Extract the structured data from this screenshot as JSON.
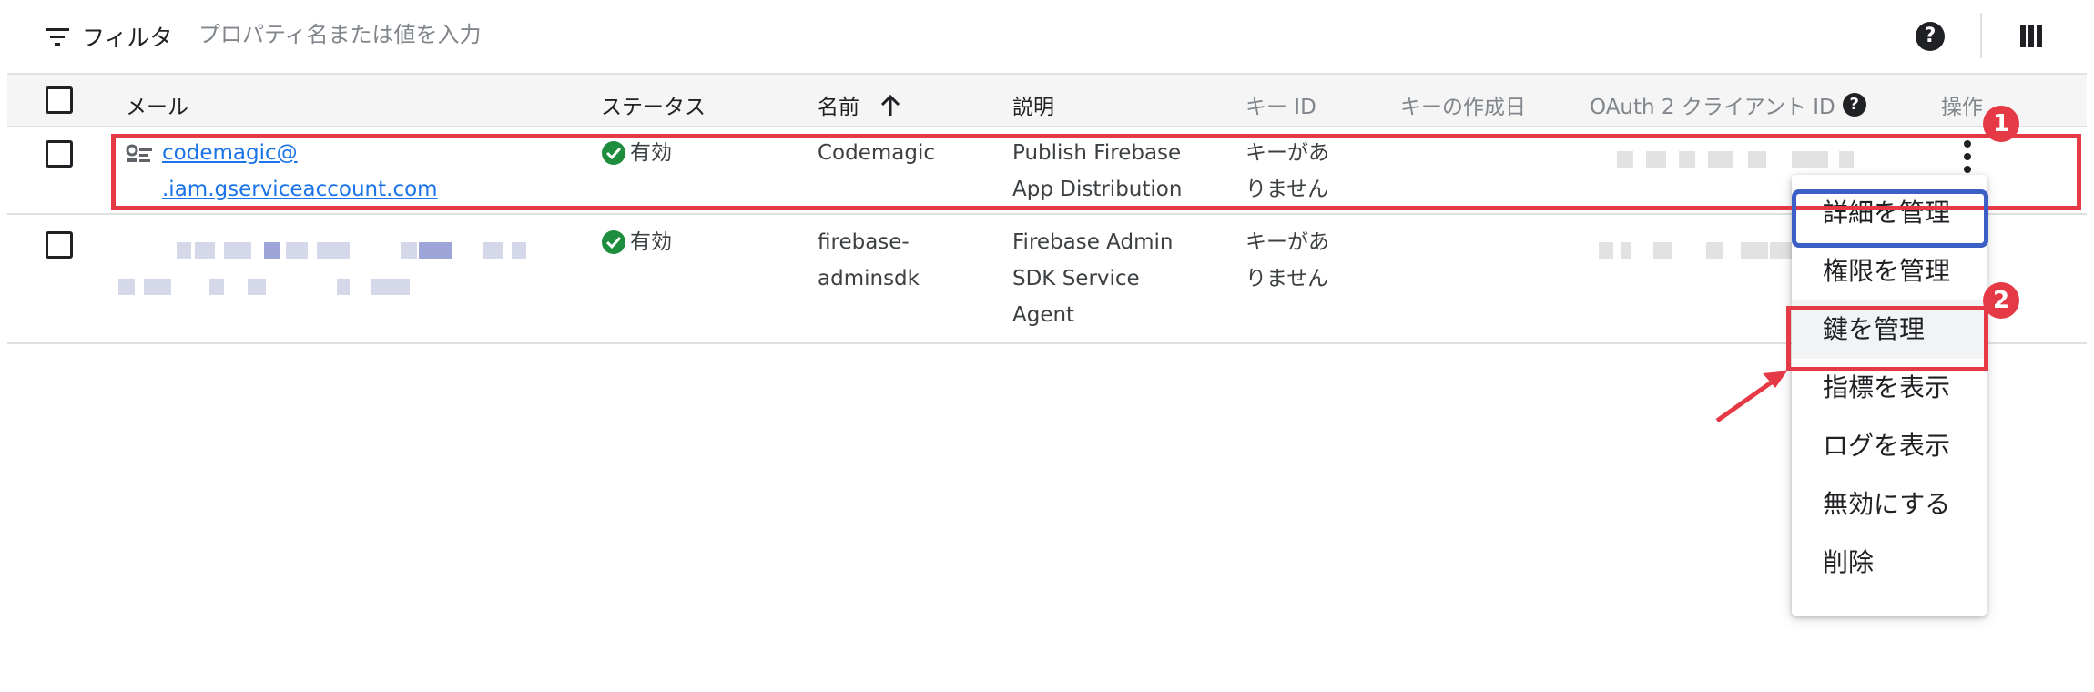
{
  "toolbar": {
    "filter_label": "フィルタ",
    "filter_placeholder": "プロパティ名または値を入力",
    "help_label": "?"
  },
  "table": {
    "columns": [
      {
        "key": "email",
        "label": "メール"
      },
      {
        "key": "status",
        "label": "ステータス"
      },
      {
        "key": "name",
        "label": "名前"
      },
      {
        "key": "description",
        "label": "説明"
      },
      {
        "key": "key_id",
        "label": "キー ID"
      },
      {
        "key": "key_created",
        "label": "キーの作成日"
      },
      {
        "key": "oauth_client_id",
        "label": "OAuth 2 クライアント ID"
      },
      {
        "key": "actions",
        "label": "操作"
      }
    ],
    "rows": [
      {
        "email_line1": "codemagic@",
        "email_line2": ".iam.gserviceaccount.com",
        "status": "有効",
        "name": "Codemagic",
        "description_line1": "Publish Firebase",
        "description_line2": "App Distribution",
        "key_id_line1": "キーがあ",
        "key_id_line2": "りません"
      },
      {
        "status": "有効",
        "name_line1": "firebase-",
        "name_line2": "adminsdk",
        "description_line1": "Firebase Admin",
        "description_line2": "SDK Service",
        "description_line3": "Agent",
        "key_id_line1": "キーがあ",
        "key_id_line2": "りません"
      }
    ]
  },
  "menu": {
    "items": [
      {
        "label": "詳細を管理"
      },
      {
        "label": "権限を管理"
      },
      {
        "label": "鍵を管理"
      },
      {
        "label": "指標を表示"
      },
      {
        "label": "ログを表示"
      },
      {
        "label": "無効にする"
      },
      {
        "label": "削除"
      }
    ]
  },
  "annotations": {
    "badge_1": "1",
    "badge_2": "2",
    "red": "#e53945",
    "blue": "#3b5fc4"
  },
  "colors": {
    "link": "#1a73e8",
    "status_ok": "#1e8e3e",
    "header_bg": "#f5f5f5"
  }
}
